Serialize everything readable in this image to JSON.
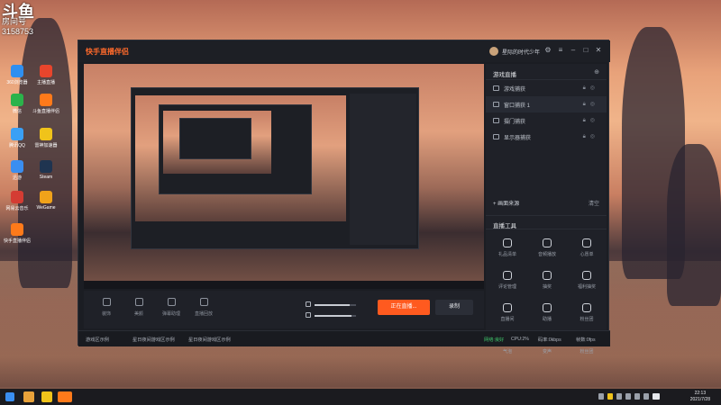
{
  "watermark": {
    "line1": "斗鱼",
    "line2": "房间号",
    "line3": "3158753"
  },
  "desktop_icons": [
    {
      "label": "360浏览器",
      "color": "#2f8ff0"
    },
    {
      "label": "主播直播",
      "color": "#e8452c"
    },
    {
      "label": "微信",
      "color": "#2bb34b"
    },
    {
      "label": "斗鱼直播伴侣",
      "color": "#ff7a1a"
    },
    {
      "label": "腾讯QQ",
      "color": "#3aa0f5"
    },
    {
      "label": "雷神加速器",
      "color": "#f0c31a"
    },
    {
      "label": "迅游",
      "color": "#3a8ef0"
    },
    {
      "label": "Steam",
      "color": "#1f3450"
    },
    {
      "label": "网易云音乐",
      "color": "#d43c33"
    },
    {
      "label": "WeGame",
      "color": "#f0a21a"
    },
    {
      "label": "快手直播伴侣",
      "color": "#ff7a1a"
    }
  ],
  "window": {
    "app_name": "快手直播伴侣",
    "user_name": "星际的时代少年",
    "controls": {
      "settings": "⚙",
      "menu": "≡",
      "minimize": "–",
      "maximize": "□",
      "close": "✕"
    }
  },
  "scenes_panel": {
    "title": "游戏直播",
    "add_icon": "⊕",
    "scenes": [
      {
        "label": "游戏捕获",
        "active": false
      },
      {
        "label": "窗口捕获 1",
        "active": true
      },
      {
        "label": "摄门捕获",
        "active": false
      },
      {
        "label": "显示器捕获",
        "active": false
      }
    ],
    "add_source_label": "+ 画面来源",
    "clear_label": "清空"
  },
  "tools_panel": {
    "title": "直播工具",
    "tools": [
      {
        "label": "礼品清单",
        "icon": "link-icon"
      },
      {
        "label": "音频播放",
        "icon": "music-icon"
      },
      {
        "label": "心愿单",
        "icon": "heart-icon"
      },
      {
        "label": "评论管理",
        "icon": "comment-icon"
      },
      {
        "label": "抽奖",
        "icon": "gift-icon"
      },
      {
        "label": "福利抽奖",
        "icon": "present-icon"
      },
      {
        "label": "直播间",
        "icon": "shield-icon"
      },
      {
        "label": "助播",
        "icon": "cast-icon"
      },
      {
        "label": "粉丝团",
        "icon": "fans-icon"
      },
      {
        "label": "气泡",
        "icon": "brush-icon"
      },
      {
        "label": "变声",
        "icon": "search-icon"
      },
      {
        "label": "粉丝团",
        "icon": "user-icon"
      }
    ]
  },
  "controls_bar": {
    "buttons": [
      {
        "label": "装饰",
        "icon": "decor-icon"
      },
      {
        "label": "美颜",
        "icon": "beauty-icon"
      },
      {
        "label": "弹幕助理",
        "icon": "chat-icon"
      },
      {
        "label": "直播回放",
        "icon": "camera-icon"
      }
    ],
    "mic_level": 0.85,
    "speaker_level": 0.9,
    "live_button": "正在直播...",
    "record_button": "录制"
  },
  "status_bar": {
    "items": [
      "游戏区示例",
      "星日夜间游戏区示例",
      "星日夜间游戏区示例"
    ],
    "network": "网络:良好",
    "cpu": "CPU:2%",
    "bitrate": "码率:0kbps",
    "fps": "帧数:0fps"
  },
  "taskbar": {
    "time": "22:13",
    "date": "2021/7/28"
  }
}
